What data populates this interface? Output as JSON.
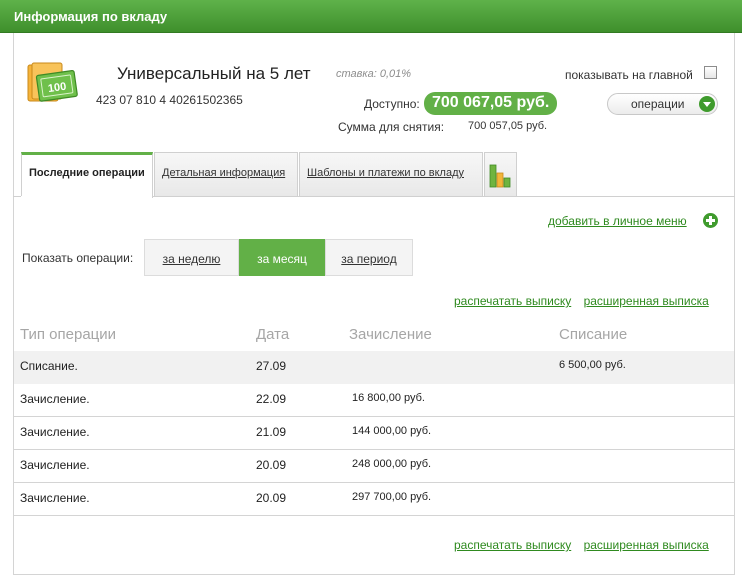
{
  "header": {
    "title": "Информация по вкладу"
  },
  "account": {
    "name": "Универсальный на 5 лет",
    "rate": "ставка: 0,01%",
    "number": "423 07 810 4 40261502365",
    "available_label": "Доступно:",
    "available_amount": "700 067,05 руб.",
    "withdraw_label": "Сумма для снятия:",
    "withdraw_amount": "700 057,05 руб.",
    "show_on_main_label": "показывать на главной",
    "operations_button": "операции",
    "money_icon_label": "100"
  },
  "tabs": [
    {
      "label": "Последние операции",
      "active": true
    },
    {
      "label": "Детальная информация",
      "active": false
    },
    {
      "label": "Шаблоны и платежи по вкладу",
      "active": false
    }
  ],
  "add_to_menu": "добавить в личное меню",
  "period": {
    "label": "Показать операции:",
    "options": [
      {
        "label": "за неделю",
        "active": false
      },
      {
        "label": "за месяц",
        "active": true
      },
      {
        "label": "за период",
        "active": false
      }
    ]
  },
  "links": {
    "print": "распечатать выписку",
    "extended": "расширенная выписка"
  },
  "table": {
    "headers": [
      "Тип операции",
      "Дата",
      "Зачисление",
      "Списание"
    ],
    "rows": [
      {
        "type": "Списание.",
        "date": "27.09",
        "credit": "",
        "debit": "6 500,00 руб."
      },
      {
        "type": "Зачисление.",
        "date": "22.09",
        "credit": "16 800,00 руб.",
        "debit": ""
      },
      {
        "type": "Зачисление.",
        "date": "21.09",
        "credit": "144 000,00 руб.",
        "debit": ""
      },
      {
        "type": "Зачисление.",
        "date": "20.09",
        "credit": "248 000,00 руб.",
        "debit": ""
      },
      {
        "type": "Зачисление.",
        "date": "20.09",
        "credit": "297 700,00 руб.",
        "debit": ""
      }
    ]
  },
  "colors": {
    "brand_green": "#62b047",
    "header_green": "#3f8f2c",
    "link_green": "#2f8a1f"
  }
}
